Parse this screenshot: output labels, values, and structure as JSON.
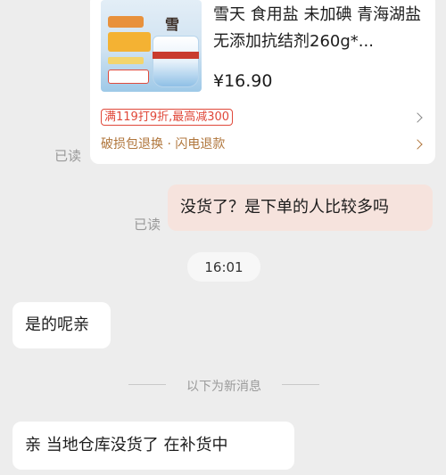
{
  "product_card": {
    "title": "雪天 食用盐 未加碘 青海湖盐无添加抗结剂260g*...",
    "price": "¥16.90",
    "promo": "满119打9折,最高减300",
    "service": "破损包退换 · 闪电退款",
    "thumb_logo": "雪天"
  },
  "messages": [
    {
      "from": "me",
      "text": "没货了？是下单的人比较多吗",
      "read": "已读"
    },
    {
      "from": "them",
      "text": "是的呢亲"
    },
    {
      "from": "them",
      "text": "亲  当地仓库没货了  在补货中"
    }
  ],
  "read_marks": {
    "card": "已读",
    "msg1": "已读"
  },
  "timestamp": "16:01",
  "divider": "以下为新消息",
  "colors": {
    "background": "#ededed",
    "outgoing_bubble": "#f6e3dd",
    "incoming_bubble": "#ffffff",
    "promo_red": "#e0483a",
    "service_brown": "#b0763c"
  }
}
